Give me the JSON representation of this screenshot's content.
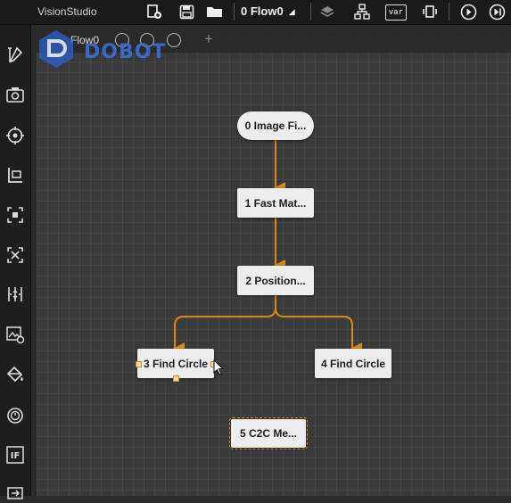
{
  "app": {
    "title": "VisionStudio"
  },
  "toolbar": {
    "flow_selector": "0 Flow0",
    "var_label": "var",
    "icons": [
      "new-flow-icon",
      "save-icon",
      "open-folder-icon",
      "layers-icon",
      "hierarchy-icon",
      "var-icon",
      "device-icon",
      "run-icon",
      "run-once-icon"
    ]
  },
  "left_toolbar": {
    "icons": [
      "tools-icon",
      "camera-icon",
      "target-icon",
      "measure-icon",
      "crop-icon",
      "pattern-icon",
      "caliper-icon",
      "image-settings-icon",
      "paint-bucket-icon",
      "timer-icon",
      "if-icon",
      "more-icon"
    ],
    "if_label": "IF"
  },
  "canvas": {
    "tab_label": "Flow0",
    "logo_text": "DOBOT"
  },
  "nodes": [
    {
      "id": "0",
      "label": "0 Image Fi..."
    },
    {
      "id": "1",
      "label": "1 Fast Mat..."
    },
    {
      "id": "2",
      "label": "2 Position..."
    },
    {
      "id": "3",
      "label": "3 Find Circle"
    },
    {
      "id": "4",
      "label": "4 Find Circle"
    },
    {
      "id": "5",
      "label": "5 C2C Me..."
    }
  ],
  "colors": {
    "wire": "#d9881a",
    "node_bg": "#ededed",
    "canvas_bg": "#3a3a3a",
    "logo": "#3a6fd6"
  }
}
